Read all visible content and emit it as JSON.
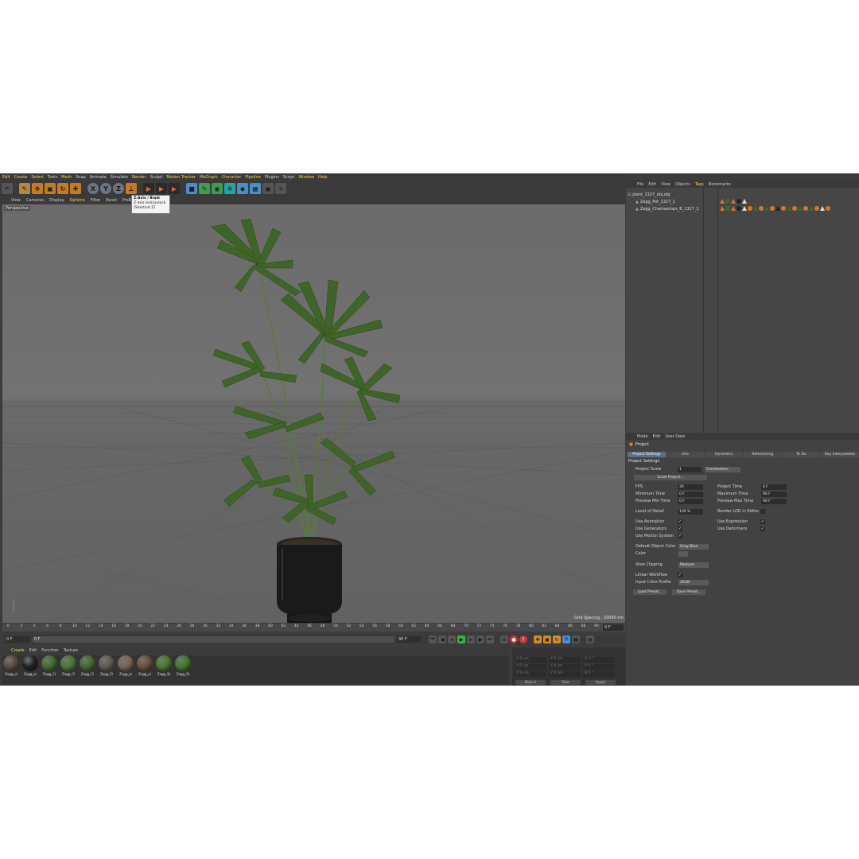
{
  "menubar": [
    "Edit",
    "Create",
    "Select",
    "Tools",
    "Mesh",
    "Snap",
    "Animate",
    "Simulate",
    "Render",
    "Sculpt",
    "Motion Tracker",
    "MoGraph",
    "Character",
    "Pipeline",
    "Plugins",
    "Script",
    "Window",
    "Help"
  ],
  "viewport_menu": [
    "View",
    "Cameras",
    "Display",
    "Options",
    "Filter",
    "Panel",
    "ProRender"
  ],
  "viewport": {
    "camera_label": "Perspective",
    "grid_spacing": "Grid Spacing : 10000 cm"
  },
  "tooltip": {
    "title": "Z-Axis / Bank",
    "line2": "Z axis lock/unlock",
    "line3": "[Shortcut Z]"
  },
  "toolbar": {
    "axis_x": "X",
    "axis_y": "Y",
    "axis_z": "Z"
  },
  "timeline": {
    "ticks": [
      "0",
      "2",
      "4",
      "6",
      "8",
      "10",
      "12",
      "14",
      "16",
      "18",
      "20",
      "22",
      "24",
      "26",
      "28",
      "30",
      "32",
      "34",
      "36",
      "38",
      "40",
      "42",
      "44",
      "46",
      "48",
      "50",
      "52",
      "54",
      "56",
      "58",
      "60",
      "62",
      "64",
      "66",
      "68",
      "70",
      "72",
      "74",
      "76",
      "78",
      "80",
      "82",
      "84",
      "86",
      "88",
      "90"
    ],
    "current_frame": "0 F"
  },
  "playback": {
    "start": "0 F",
    "current": "0 F",
    "range_end": "90 F",
    "end": "90 F"
  },
  "material_menu": [
    "Create",
    "Edit",
    "Function",
    "Texture"
  ],
  "materials": [
    {
      "name": "Zagg_pi",
      "color": "#5a4a3a"
    },
    {
      "name": "Zagg_pi",
      "color": "#1e1e1e"
    },
    {
      "name": "Zagg_Cl",
      "color": "#3f6b2a"
    },
    {
      "name": "Zagg_Cl",
      "color": "#4a7a30"
    },
    {
      "name": "Zagg_Cl",
      "color": "#3f6b2a"
    },
    {
      "name": "Zagg_Pl",
      "color": "#5e5a52"
    },
    {
      "name": "Zagg_pi",
      "color": "#7a6450"
    },
    {
      "name": "Zagg_pi",
      "color": "#6a5038"
    },
    {
      "name": "Zagg_St",
      "color": "#4a7a2a"
    },
    {
      "name": "Zagg_St",
      "color": "#3f7a2a"
    }
  ],
  "coordinates": {
    "rows": [
      {
        "a": "X",
        "av": "0 cm",
        "b": "X",
        "bv": "0 cm",
        "c": "H",
        "cv": "0 °"
      },
      {
        "a": "Y",
        "av": "0 cm",
        "b": "Y",
        "bv": "0 cm",
        "c": "P",
        "cv": "0 °"
      },
      {
        "a": "Z",
        "av": "0 cm",
        "b": "Z",
        "bv": "0 cm",
        "c": "B",
        "cv": "0 °"
      }
    ],
    "mode1": "Object",
    "mode2": "Size",
    "apply": "Apply"
  },
  "object_manager": {
    "menu": [
      "File",
      "Edit",
      "View",
      "Objects",
      "Tags",
      "Bookmarks"
    ],
    "objects": [
      {
        "name": "plant_1327_obj.obj"
      },
      {
        "name": "Zagg_Pot_1327_1"
      },
      {
        "name": "Zagg_Chamaerops_B_1327_1"
      }
    ]
  },
  "attributes": {
    "menu": [
      "Mode",
      "Edit",
      "User Data"
    ],
    "title": "Project",
    "tabs": [
      "Project Settings",
      "Info",
      "Dynamics",
      "Referencing",
      "To Do",
      "Key Interpolation"
    ],
    "section": "Project Settings",
    "project_scale_label": "Project Scale",
    "project_scale_value": "1",
    "project_scale_unit": "Centimeters",
    "scale_button": "Scale Project...",
    "fps_label": "FPS",
    "fps_value": "30",
    "project_time_label": "Project Time",
    "project_time_value": "0 F",
    "min_time_label": "Minimum Time",
    "min_time_value": "0 F",
    "max_time_label": "Maximum Time",
    "max_time_value": "90 F",
    "prev_min_label": "Preview Min Time",
    "prev_min_value": "0 F",
    "prev_max_label": "Preview Max Time",
    "prev_max_value": "90 F",
    "lod_label": "Level of Detail",
    "lod_value": "100 %",
    "render_lod_label": "Render LOD in Editor",
    "use_animation": "Use Animation",
    "use_expression": "Use Expression",
    "use_generators": "Use Generators",
    "use_deformers": "Use Deformers",
    "use_motion": "Use Motion System",
    "default_color_label": "Default Object Color",
    "default_color_value": "Gray Blue",
    "color_label": "Color",
    "view_clipping_label": "View Clipping",
    "view_clipping_value": "Medium",
    "linear_workflow_label": "Linear Workflow",
    "input_profile_label": "Input Color Profile",
    "input_profile_value": "sRGB",
    "load_preset": "Load Preset...",
    "save_preset": "Save Preset..."
  }
}
